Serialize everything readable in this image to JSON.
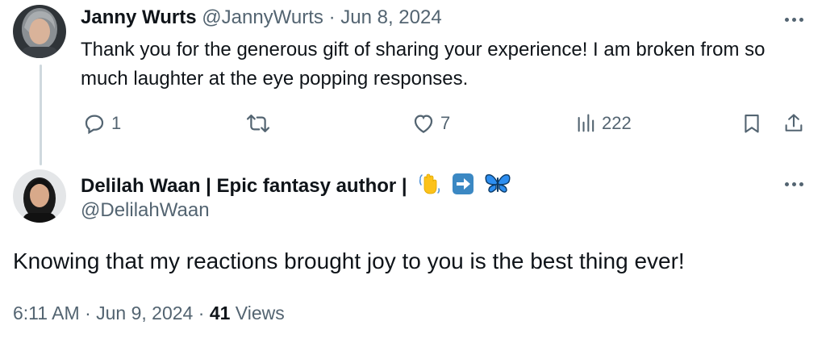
{
  "reply": {
    "author_name": "Janny Wurts",
    "handle": "@JannyWurts",
    "separator": "·",
    "date": "Jun 8, 2024",
    "text": "Thank you for the generous gift of sharing your experience! I am broken from so much laughter at the eye popping responses.",
    "stats": {
      "replies": "1",
      "likes": "7",
      "views": "222"
    }
  },
  "main": {
    "author_name": "Delilah Waan | Epic fantasy author |",
    "handle": "@DelilahWaan",
    "name_emojis": [
      "waving-hand-icon",
      "right-arrow-icon",
      "butterfly-icon"
    ],
    "text": "Knowing that my reactions brought joy to you is the best thing ever!",
    "time": "6:11 AM",
    "separator": "·",
    "date": "Jun 9, 2024",
    "separator2": "·",
    "views_count": "41",
    "views_label": "Views"
  },
  "colors": {
    "text": "#0f1419",
    "muted": "#536471",
    "thread_line": "#cfd9de",
    "arrow_blue": "#3b88c3",
    "butterfly_blue": "#2d8ef0",
    "wave_yellow": "#fcc21b"
  }
}
